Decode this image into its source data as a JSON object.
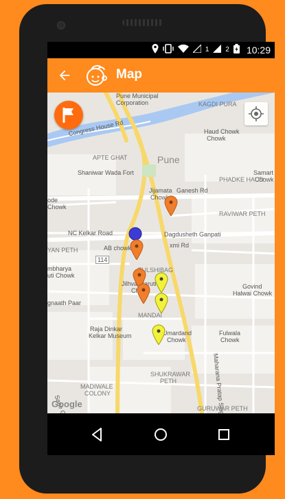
{
  "status_bar": {
    "sim1": "1",
    "sim2": "2",
    "time": "10:29"
  },
  "app_bar": {
    "title": "Map"
  },
  "map": {
    "labels": {
      "pmc": "Pune Municipal",
      "corporation": "Corporation",
      "kagdi_pura": "KAGDI PURA",
      "congress_house_rd": "Congress House Rd",
      "haud_chowk_1": "Haud Chowk",
      "haud_chowk_2": "Chowk",
      "apte_ghat": "APTE GHAT",
      "pune": "Pune",
      "shaniwar_wada": "Shaniwar Wada Fort",
      "phadke_haud": "PHADKE HAUD",
      "samart": "Samart",
      "chowk_right": "Chowk",
      "jijamata_1": "Jijamata",
      "jijamata_2": "Chowk",
      "ganesh_rd": "Ganesh Rd",
      "ode_1": "ode",
      "ode_2": "Chowk",
      "raviwar_peth": "RAVIWAR PETH",
      "nc_kelkar": "NC Kelkar Road",
      "dagdusheth": "Dagdusheth Ganpati",
      "ab_chowk": "AB chowk",
      "laxmi_rd": "xmi Rd",
      "yan_peth": "YAN PETH",
      "route_114": "114",
      "tulshibag": "TULSHIBAG",
      "bhavani_1": "mbharya",
      "bhavani_2": "uti Chowk",
      "jilhva_1": "Jilhva Maruti",
      "jilhva_2": "Chowk",
      "govind_1": "Govind",
      "govind_2": "Halwai Chowk",
      "gnaath": "gnaath Paar",
      "mandai": "MANDAI",
      "mahatma_rd": "Maharana Pratap Singh Rd",
      "raja_1": "Raja Dinkar",
      "raja_2": "Kelkar Museum",
      "umardand_1": "Umardand",
      "umardand_2": "Chowk",
      "fulwala_1": "Fulwala",
      "fulwala_2": "Chowk",
      "shukrawar_1": "SHUKRAWAR",
      "shukrawar_2": "PETH",
      "madiwale_1": "MADIWALE",
      "madiwale_2": "COLONY",
      "guruwar": "GURUWAR PETH",
      "sane_gu": "Sane Gu",
      "google": "Google"
    }
  },
  "icons": {
    "back": "arrow-left-icon",
    "logo": "child-face-logo-icon",
    "flag": "flag-icon",
    "location": "my-location-icon",
    "nav_back": "triangle-back-icon",
    "nav_home": "circle-home-icon",
    "nav_recent": "square-recents-icon"
  },
  "colors": {
    "accent": "#ff8a1e",
    "pin_orange": "#f07e2b",
    "pin_yellow": "#f2f23a",
    "pin_blue": "#3b3bd6",
    "route": "#f7d86a"
  }
}
